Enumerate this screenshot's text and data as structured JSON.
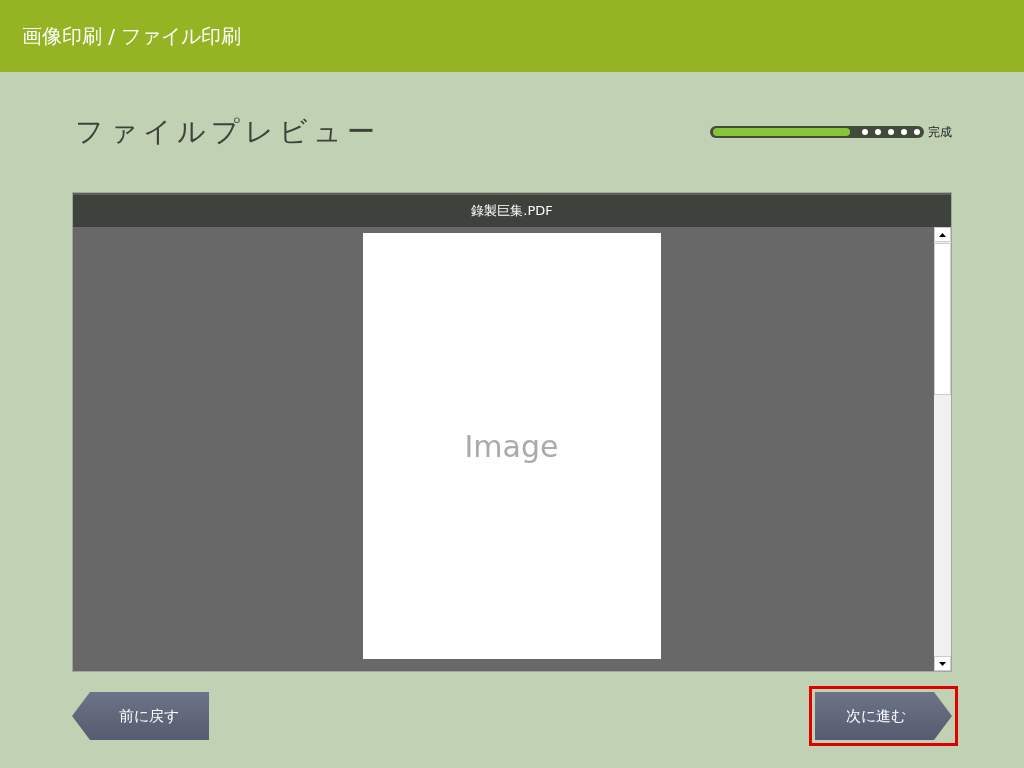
{
  "header": {
    "title": "画像印刷 / ファイル印刷"
  },
  "page_title": "ファイルプレビュー",
  "progress": {
    "level": 0.66,
    "label": "完成"
  },
  "preview": {
    "file_name": "錄製巨集.PDF",
    "page_text": "Image"
  },
  "buttons": [
    {
      "kind": "back",
      "label": "前に戻す",
      "highlighted": false
    },
    {
      "kind": "next",
      "label": "次に進む",
      "highlighted": true
    }
  ]
}
